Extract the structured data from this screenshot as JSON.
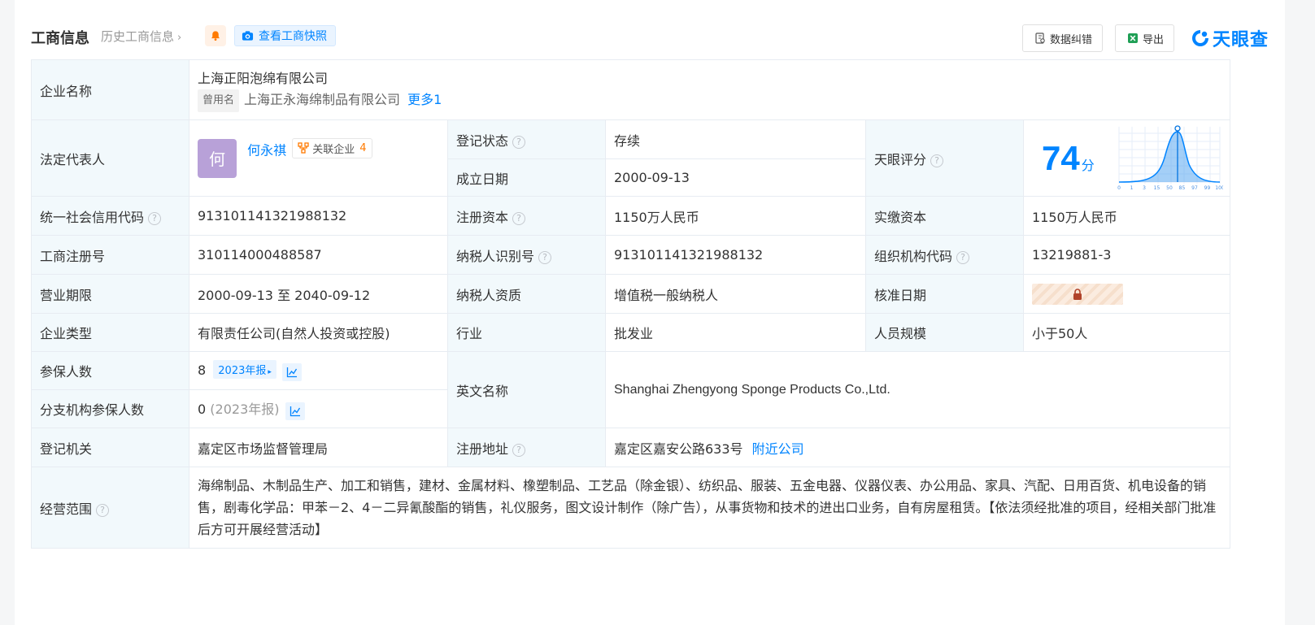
{
  "header": {
    "title": "工商信息",
    "history": "历史工商信息",
    "snapshot": "查看工商快照",
    "btn_correct": "数据纠错",
    "btn_export": "导出",
    "logo": "天眼查"
  },
  "company": {
    "name_label": "企业名称",
    "name": "上海正阳泡绵有限公司",
    "used_tag": "曾用名",
    "used_name": "上海正永海绵制品有限公司",
    "more": "更多1"
  },
  "legal": {
    "label": "法定代表人",
    "avatar_char": "何",
    "name": "何永祺",
    "rel_label": "关联企业",
    "rel_count": "4"
  },
  "reg_status": {
    "label": "登记状态",
    "value": "存续"
  },
  "found_date": {
    "label": "成立日期",
    "value": "2000-09-13"
  },
  "score": {
    "label": "天眼评分",
    "value": "74",
    "unit": "分",
    "axis": [
      "0",
      "1",
      "3",
      "15",
      "50",
      "85",
      "97",
      "99",
      "100"
    ]
  },
  "credit_code": {
    "label": "统一社会信用代码",
    "value": "913101141321988132"
  },
  "reg_capital": {
    "label": "注册资本",
    "value": "1150万人民币"
  },
  "paid_capital": {
    "label": "实缴资本",
    "value": "1150万人民币"
  },
  "reg_no": {
    "label": "工商注册号",
    "value": "310114000488587"
  },
  "taxpayer_id": {
    "label": "纳税人识别号",
    "value": "913101141321988132"
  },
  "org_code": {
    "label": "组织机构代码",
    "value": "13219881-3"
  },
  "term": {
    "label": "营业期限",
    "value": "2000-09-13 至 2040-09-12"
  },
  "tax_qual": {
    "label": "纳税人资质",
    "value": "增值税一般纳税人"
  },
  "approve_date": {
    "label": "核准日期"
  },
  "type": {
    "label": "企业类型",
    "value": "有限责任公司(自然人投资或控股)"
  },
  "industry": {
    "label": "行业",
    "value": "批发业"
  },
  "staff": {
    "label": "人员规模",
    "value": "小于50人"
  },
  "insured": {
    "label": "参保人数",
    "value": "8",
    "year_tag": "2023年报"
  },
  "branch_insured": {
    "label": "分支机构参保人数",
    "value": "0",
    "year": "(2023年报)"
  },
  "english": {
    "label": "英文名称",
    "value": "Shanghai Zhengyong Sponge Products Co.,Ltd."
  },
  "authority": {
    "label": "登记机关",
    "value": "嘉定区市场监督管理局"
  },
  "address": {
    "label": "注册地址",
    "value": "嘉定区嘉安公路633号",
    "nearby": "附近公司"
  },
  "scope": {
    "label": "经营范围",
    "value": "海绵制品、木制品生产、加工和销售，建材、金属材料、橡塑制品、工艺品（除金银）、纺织品、服装、五金电器、仪器仪表、办公用品、家具、汽配、日用百货、机电设备的销售，剧毒化学品：甲苯－2、4－二异氰酸酯的销售，礼仪服务，图文设计制作（除广告），从事货物和技术的进出口业务，自有房屋租赁。【依法须经批准的项目，经相关部门批准后方可开展经营活动】"
  },
  "help_mark": "?",
  "colors": {
    "accent": "#0084ff",
    "label_bg": "#f2f9fc",
    "status_green": "#23a051"
  }
}
